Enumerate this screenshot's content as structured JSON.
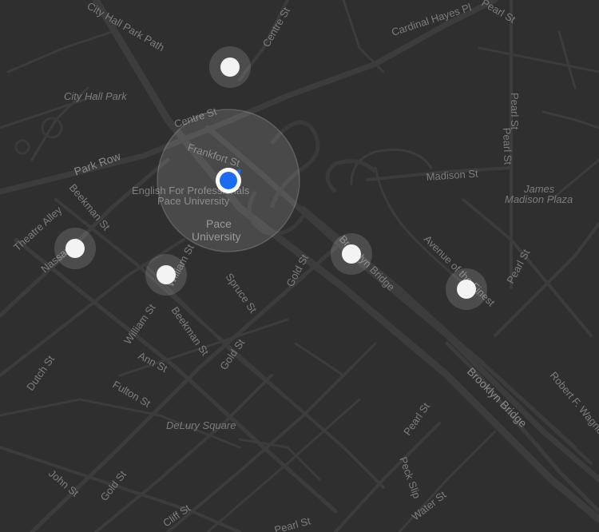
{
  "map": {
    "colors": {
      "background": "#2f2f2f",
      "road": "#3d3d3d",
      "road_major": "#454545",
      "label": "#7d7d7d",
      "accent_location": "#1a6df2",
      "marker_fill": "#f3f3f3",
      "marker_halo": "#ffffff",
      "accuracy_circle": "#ffffff"
    },
    "labels": {
      "city_hall_park_path": "City Hall Park Path",
      "centre_st_top": "Centre St",
      "cardinal_hayes": "Cardinal Hayes Pl",
      "pearl_st_top": "Pearl St",
      "city_hall_park": "City Hall Park",
      "centre_st_mid": "Centre St",
      "pearl_st_right": "Pearl St",
      "pearl_st_right2": "Pearl St",
      "frankfort": "Frankfort St",
      "park_row": "Park Row",
      "madison_st": "Madison St",
      "english_pros": "English For Professionals",
      "pace_small": "Pace University",
      "james_madison": "James",
      "james_madison2": "Madison Plaza",
      "beekman_st_left": "Beekman St",
      "theatre_alley": "Theatre Alley",
      "pace_big": "Pace",
      "pace_big2": "University",
      "pearl_st_far_right": "Pearl St",
      "nassau": "Nassau St",
      "william_upper": "William St",
      "spruce": "Spruce St",
      "gold_upper": "Gold St",
      "brooklyn_bridge_upper": "Brooklyn Bridge",
      "avenue_finest": "Avenue of the Finest",
      "william_lower": "William St",
      "beekman_lower": "Beekman St",
      "ann": "Ann St",
      "gold_mid": "Gold St",
      "dutch": "Dutch St",
      "fulton": "Fulton St",
      "brooklyn_bridge_lower": "Brooklyn Bridge",
      "robert_wagner": "Robert F. Wagner",
      "delury": "DeLury Square",
      "pearl_lower": "Pearl St",
      "john": "John St",
      "gold_lower": "Gold St",
      "peck_slip": "Peck Slip",
      "cliff": "Cliff St",
      "pearl_bottom": "Pearl St",
      "water": "Water St"
    },
    "markers": [
      {
        "name": "marker-pin",
        "label": ""
      },
      {
        "name": "marker-pin",
        "label": ""
      },
      {
        "name": "marker-pin",
        "label": ""
      },
      {
        "name": "marker-pin",
        "label": ""
      },
      {
        "name": "marker-pin",
        "label": ""
      }
    ],
    "current_location": {
      "icon": "location-dot-icon"
    }
  }
}
